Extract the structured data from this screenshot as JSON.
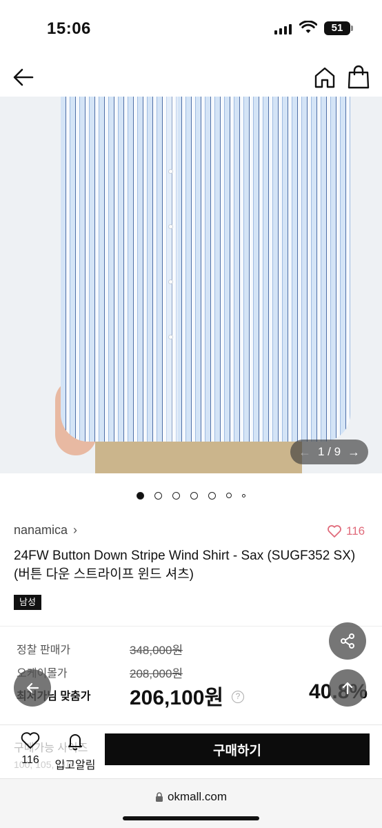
{
  "status": {
    "time": "15:06",
    "battery": "51"
  },
  "header": {
    "back_icon": "arrow-left-icon",
    "home_icon": "home-icon",
    "bag_icon": "shopping-bag-icon"
  },
  "gallery": {
    "current": "1",
    "total": "9",
    "counter": "1 / 9",
    "dot_count": 6,
    "active_dot": 0
  },
  "product": {
    "brand": "nanamica",
    "brand_chevron": "›",
    "likes": "116",
    "title": "24FW  Button Down Stripe Wind Shirt - Sax (SUGF352 SX) (버튼 다운 스트라이프 윈드 셔츠)",
    "gender": "남성"
  },
  "pricing": {
    "regular_label": "정찰 판매가",
    "regular_price": "348,000원",
    "okmall_label": "오케이몰가",
    "okmall_price": "208,000원",
    "best_label": "최저가님 맞춤가",
    "best_price": "206,100원",
    "help": "?",
    "discount": "40.8%"
  },
  "sizes": {
    "label": "구매가능 사이즈",
    "values": "100, 105, 110"
  },
  "bottom": {
    "likes": "116",
    "alert_label": "입고알림",
    "buy_label": "구매하기"
  },
  "browser": {
    "url": "okmall.com"
  },
  "colors": {
    "accent_like": "#e06a7a",
    "buy_bg": "#0c0c0c"
  }
}
